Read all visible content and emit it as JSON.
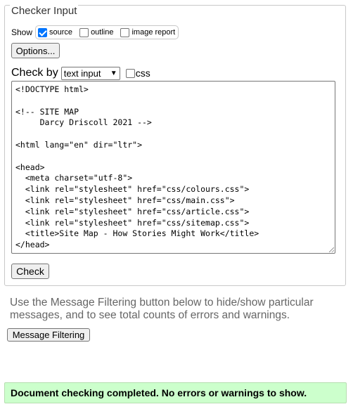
{
  "checker": {
    "legend": "Checker Input",
    "show_label": "Show",
    "show_options": [
      {
        "label": "source",
        "checked": true
      },
      {
        "label": "outline",
        "checked": false
      },
      {
        "label": "image report",
        "checked": false
      }
    ],
    "options_button": "Options...",
    "check_by_label": "Check by",
    "check_by_selected": "text input",
    "css_label": "css",
    "css_checked": false,
    "source_text": "<!DOCTYPE html>\n\n<!-- SITE MAP\n     Darcy Driscoll 2021 -->\n\n<html lang=\"en\" dir=\"ltr\">\n\n<head>\n  <meta charset=\"utf-8\">\n  <link rel=\"stylesheet\" href=\"css/colours.css\">\n  <link rel=\"stylesheet\" href=\"css/main.css\">\n  <link rel=\"stylesheet\" href=\"css/article.css\">\n  <link rel=\"stylesheet\" href=\"css/sitemap.css\">\n  <title>Site Map - How Stories Might Work</title>\n</head>",
    "check_button": "Check"
  },
  "filtering": {
    "help_text": "Use the Message Filtering button below to hide/show particular messages, and to see total counts of errors and warnings.",
    "button": "Message Filtering"
  },
  "status": {
    "message": "Document checking completed. No errors or warnings to show.",
    "color": "#ccffcc"
  }
}
